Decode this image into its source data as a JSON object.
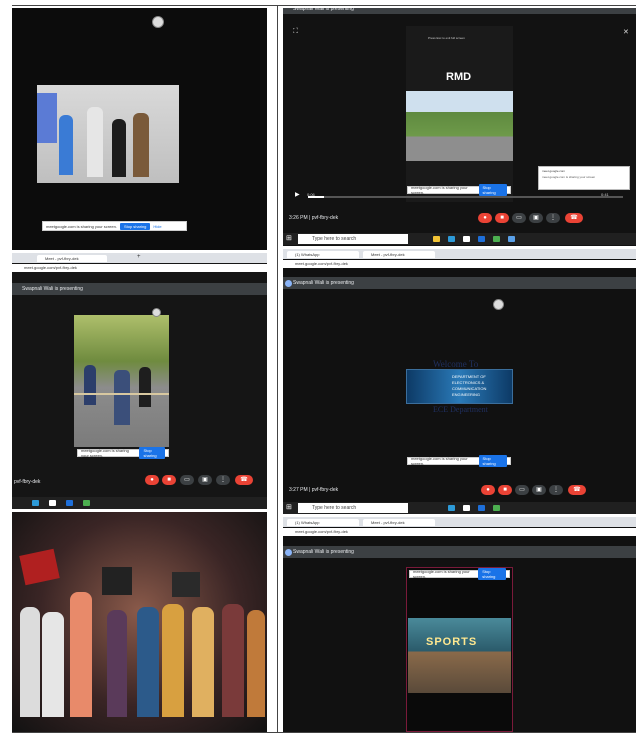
{
  "presenting_banner": "Swapnali Wali is presenting",
  "share_notice": {
    "text": "meetgoogle.com is sharing your screen.",
    "stop_label": "Stop sharing",
    "hide_label": "Hide"
  },
  "meeting": {
    "code": "pvf-fbry-dek",
    "time_top": "3:26 PM",
    "time_mid": "3:27 PM",
    "clip_time_left": "0:06",
    "clip_time_right": "0:41"
  },
  "taskbar": {
    "search_placeholder": "Type here to search"
  },
  "browser": {
    "url": "meet.google.com/pvf-fbry-dek",
    "tab_meet": "Meet - pvf-fbry-dek",
    "tab_whatsapp": "(1) WhatsApp"
  },
  "video": {
    "overlay_text": "RMD",
    "tap_hint": "Press Esc to exit full screen",
    "welcome_heading": "Welcome To",
    "dept_banner_lines": [
      "DEPARTMENT OF",
      "ELECTRONICS &",
      "COMMUNICATION",
      "ENGINEERING"
    ],
    "dept_caption": "ECE Department",
    "sign_text": "SPORTS"
  },
  "notification": {
    "title": "meet.google.com",
    "body": "meet.google.com is sharing your screen"
  },
  "icons": {
    "logo": "college-logo-icon",
    "mic": "mic-off-icon",
    "cam": "camera-off-icon",
    "end": "end-call-icon"
  },
  "colors": {
    "meet_red": "#ea4335",
    "meet_blue": "#1a73e8",
    "banner": "#3c4043",
    "presenter_dot": "#8ab4f8"
  }
}
